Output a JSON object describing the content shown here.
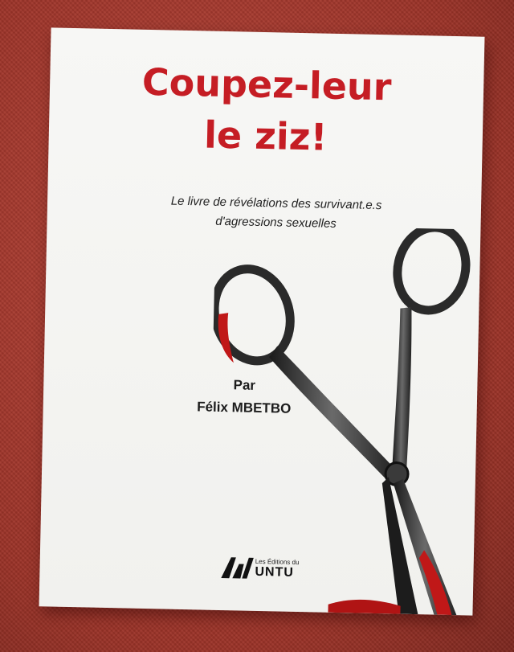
{
  "book": {
    "title_line1": "Coupez-leur",
    "title_line2": "le ziz!",
    "subtitle_line1": "Le livre de révélations des survivant.e.s",
    "subtitle_line2": "d'agressions sexuelles",
    "author_prefix": "Par",
    "author_name": "Félix MBETBO",
    "publisher_small": "Les Éditions du",
    "publisher_big": "UNTU"
  },
  "colors": {
    "title": "#c51d24",
    "background_fabric": "#a8392c",
    "cover": "#f4f4f2",
    "blood": "#c01818"
  },
  "illustration": {
    "subject": "bloody-scissors-icon"
  }
}
